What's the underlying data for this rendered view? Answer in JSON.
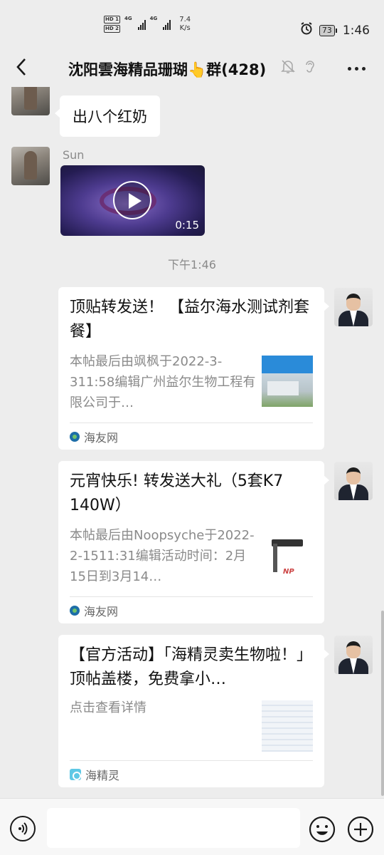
{
  "status_bar": {
    "hd1": "HD 1",
    "hd2": "HD 2",
    "net1": "4G",
    "net2": "4G",
    "speed_value": "7.4",
    "speed_unit": "K/s",
    "battery": "73",
    "time": "1:46"
  },
  "header": {
    "title": "沈阳雲海精品珊瑚👆群(428)",
    "back_icon": "chevron-left-icon",
    "mute_icon": "bell-off-icon",
    "ear_icon": "ear-icon",
    "more_icon": "more-dots-icon"
  },
  "messages": [
    {
      "type": "text",
      "sender": "Sun",
      "text": "出八个红奶"
    },
    {
      "type": "video",
      "sender": "Sun",
      "duration": "0:15"
    }
  ],
  "time_separator": "下午1:46",
  "cards": [
    {
      "title": "顶贴转发送！ 【益尔海水测试剂套餐】",
      "description": "本帖最后由飒枫于2022-3-311:58编辑广州益尔生物工程有限公司于…",
      "source": "海友网",
      "source_icon": "haiyou-logo-icon"
    },
    {
      "title": "元宵快乐! 转发送大礼（5套K7 140W）",
      "description": "本帖最后由Noopsyche于2022-2-1511:31编辑活动时间：2月15日到3月14…",
      "source": "海友网",
      "source_icon": "haiyou-logo-icon",
      "thumb_label": "NP"
    },
    {
      "title": "【官方活动】「海精灵卖生物啦！」顶帖盖楼，免费拿小…",
      "description": "点击查看详情",
      "source": "海精灵",
      "source_icon": "haijingling-logo-icon"
    }
  ],
  "input_bar": {
    "voice_icon": "voice-icon",
    "input_value": "",
    "emoji_icon": "emoji-icon",
    "plus_icon": "plus-icon"
  },
  "colors": {
    "background": "#ededed",
    "bubble": "#ffffff",
    "meta_text": "#8a8a8a"
  }
}
